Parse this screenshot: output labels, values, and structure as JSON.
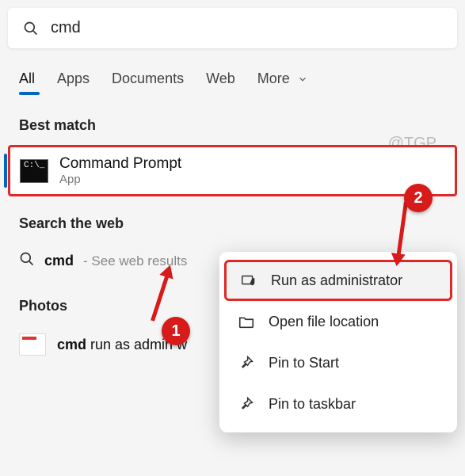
{
  "search": {
    "value": "cmd"
  },
  "tabs": {
    "all": "All",
    "apps": "Apps",
    "documents": "Documents",
    "web": "Web",
    "more": "More"
  },
  "watermark": "@TGP",
  "sections": {
    "best_match": "Best match",
    "search_web": "Search the web",
    "photos": "Photos"
  },
  "best_match_item": {
    "title": "Command Prompt",
    "subtitle": "App",
    "icon_text": "C:\\_"
  },
  "web_result": {
    "query": "cmd",
    "hint": "- See web results"
  },
  "photo_result": {
    "bold": "cmd",
    "rest": " run as admin w"
  },
  "context_menu": {
    "run_admin": "Run as administrator",
    "open_location": "Open file location",
    "pin_start": "Pin to Start",
    "pin_taskbar": "Pin to taskbar"
  },
  "annotations": {
    "badge1": "1",
    "badge2": "2"
  }
}
